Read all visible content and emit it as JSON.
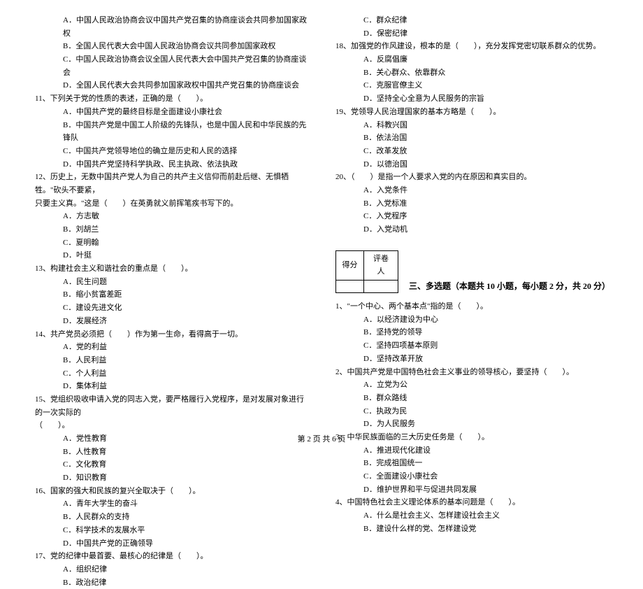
{
  "left": {
    "q10_options": [
      "A．中国人民政治协商会议中国共产党召集的协商座谈会共同参加国家政权",
      "B．全国人民代表大会中国人民政治协商会议共同参加国家政权",
      "C．中国人民政治协商会议全国人民代表大会中国共产党召集的协商座谈会",
      "D．全国人民代表大会共同参加国家政权中国共产党召集的协商座谈会"
    ],
    "q11": "11、下列关于党的性质的表述，正确的是（　　）。",
    "q11_options": [
      "A．中国共产党的最终目标是全面建设小康社会",
      "B．中国共产党是中国工人阶级的先锋队，也是中国人民和中华民族的先锋队",
      "C．中国共产党领导地位的确立是历史和人民的选择",
      "D．中国共产党坚持科学执政、民主执政、依法执政"
    ],
    "q12_line1": "12、历史上，无数中国共产党人为自己的共产主义信仰而前赴后继、无惧牺牲。\"砍头不要紧，",
    "q12_line2": "只要主义真。\"这是（　　）在英勇就义前挥笔疾书写下的。",
    "q12_options": [
      "A．方志敏",
      "B．刘胡兰",
      "C．夏明翰",
      "D．叶挺"
    ],
    "q13": "13、构建社会主义和谐社会的重点是（　　）。",
    "q13_options": [
      "A．民生问题",
      "B．缩小贫富差距",
      "C．建设先进文化",
      "D．发展经济"
    ],
    "q14": "14、共产党员必须把（　　）作为第一生命，看得高于一切。",
    "q14_options": [
      "A．党的利益",
      "B．人民利益",
      "C．个人利益",
      "D．集体利益"
    ],
    "q15_line1": "15、党组织吸收申请入党的同志入党，要严格履行入党程序，是对发展对象进行的一次实际的",
    "q15_line2": "（　　）。",
    "q15_options": [
      "A．党性教育",
      "B．人性教育",
      "C．文化教育",
      "D．知识教育"
    ],
    "q16": "16、国家的强大和民族的复兴全取决于（　　）。",
    "q16_options": [
      "A．青年大学生的奋斗",
      "B．人民群众的支持",
      "C．科学技术的发展水平",
      "D．中国共产党的正确领导"
    ],
    "q17": "17、党的纪律中最首要、最核心的纪律是（　　）。",
    "q17_options": [
      "A．组织纪律",
      "B．政治纪律"
    ]
  },
  "right": {
    "q17_options_cont": [
      "C．群众纪律",
      "D．保密纪律"
    ],
    "q18": "18、加强党的作风建设，根本的是（　　），充分发挥党密切联系群众的优势。",
    "q18_options": [
      "A．反腐倡廉",
      "B．关心群众、依靠群众",
      "C．克服官僚主义",
      "D．坚持全心全意为人民服务的宗旨"
    ],
    "q19": "19、党领导人民治理国家的基本方略是（　　）。",
    "q19_options": [
      "A．科教兴国",
      "B．依法治国",
      "C．改革发放",
      "D．以德治国"
    ],
    "q20": "20、（　　）是指一个人要求入党的内在原因和真实目的。",
    "q20_options": [
      "A．入党条件",
      "B．入党标准",
      "C．入党程序",
      "D．入党动机"
    ],
    "score_header1": "得分",
    "score_header2": "评卷人",
    "section3_title": "三、多选题（本题共 10 小题，每小题 2 分，共 20 分）",
    "m1": "1、\"一个中心、两个基本点\"指的是（　　）。",
    "m1_options": [
      "A．以经济建设为中心",
      "B．坚持党的领导",
      "C．坚持四项基本原则",
      "D．坚持改革开放"
    ],
    "m2": "2、中国共产党是中国特色社会主义事业的领导核心，要坚持（　　）。",
    "m2_options": [
      "A．立党为公",
      "B．群众路线",
      "C．执政为民",
      "D．为人民服务"
    ],
    "m3": "3、中华民族面临的三大历史任务是（　　）。",
    "m3_options": [
      "A．推进现代化建设",
      "B．完成祖国统一",
      "C．全面建设小康社会",
      "D．维护世界和平与促进共同发展"
    ],
    "m4": "4、中国特色社会主义理论体系的基本问题是（　　）。",
    "m4_options": [
      "A．什么是社会主义、怎样建设社会主义",
      "B．建设什么样的党、怎样建设党"
    ]
  },
  "footer": "第 2 页  共 6 页"
}
